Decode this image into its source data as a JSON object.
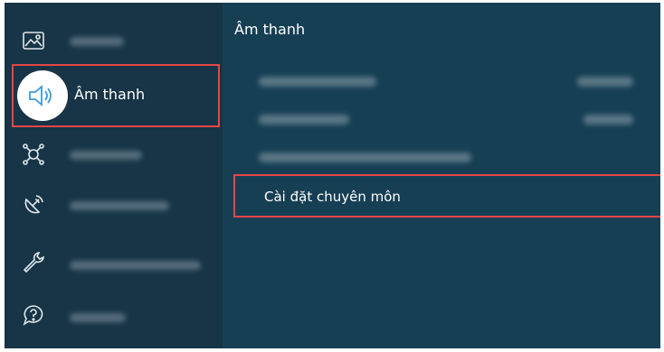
{
  "sidebar": {
    "selected_label": "Âm thanh",
    "items": [
      {
        "icon": "picture-icon"
      },
      {
        "icon": "speaker-icon",
        "label": "Âm thanh"
      },
      {
        "icon": "network-icon"
      },
      {
        "icon": "satellite-icon"
      },
      {
        "icon": "wrench-icon"
      },
      {
        "icon": "help-icon"
      }
    ]
  },
  "panel": {
    "title": "Âm thanh",
    "rows": [
      {
        "label": "",
        "value": ""
      },
      {
        "label": "",
        "value": ""
      },
      {
        "label": ""
      },
      {
        "label": "Cài đặt chuyên môn"
      }
    ]
  },
  "colors": {
    "sidebar_bg": "#173546",
    "panel_bg": "#173f54",
    "focus_border": "#e64545"
  }
}
